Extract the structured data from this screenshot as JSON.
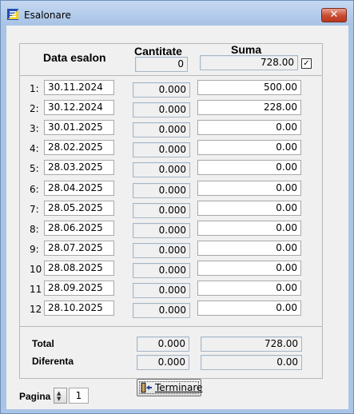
{
  "window": {
    "title": "Esalonare",
    "close_label": "✕",
    "icon": "app-document-icon"
  },
  "header": {
    "date_label": "Data esalon",
    "qty_label": "Cantitate",
    "sum_label": "Suma",
    "qty_total": "0",
    "sum_total": "728.00",
    "sum_checked": true
  },
  "rows": [
    {
      "num": "1:",
      "date": "30.11.2024",
      "qty": "0.000",
      "sum": "500.00"
    },
    {
      "num": "2:",
      "date": "30.12.2024",
      "qty": "0.000",
      "sum": "228.00"
    },
    {
      "num": "3:",
      "date": "30.01.2025",
      "qty": "0.000",
      "sum": "0.00"
    },
    {
      "num": "4:",
      "date": "28.02.2025",
      "qty": "0.000",
      "sum": "0.00"
    },
    {
      "num": "5:",
      "date": "28.03.2025",
      "qty": "0.000",
      "sum": "0.00"
    },
    {
      "num": "6:",
      "date": "28.04.2025",
      "qty": "0.000",
      "sum": "0.00"
    },
    {
      "num": "7:",
      "date": "28.05.2025",
      "qty": "0.000",
      "sum": "0.00"
    },
    {
      "num": "8:",
      "date": "28.06.2025",
      "qty": "0.000",
      "sum": "0.00"
    },
    {
      "num": "9:",
      "date": "28.07.2025",
      "qty": "0.000",
      "sum": "0.00"
    },
    {
      "num": "10",
      "date": "28.08.2025",
      "qty": "0.000",
      "sum": "0.00"
    },
    {
      "num": "11",
      "date": "28.09.2025",
      "qty": "0.000",
      "sum": "0.00"
    },
    {
      "num": "12",
      "date": "28.10.2025",
      "qty": "0.000",
      "sum": "0.00"
    }
  ],
  "totals": {
    "total_label": "Total",
    "total_qty": "0.000",
    "total_sum": "728.00",
    "diff_label": "Diferenta",
    "diff_qty": "0.000",
    "diff_sum": "0.00"
  },
  "footer": {
    "page_label": "Pagina",
    "page_value": "1",
    "finish_label": "Terminare",
    "finish_icon": "exit-door-icon"
  },
  "colors": {
    "frame": "#aac4e6",
    "client": "#f0f0f0",
    "close": "#c84a30"
  }
}
